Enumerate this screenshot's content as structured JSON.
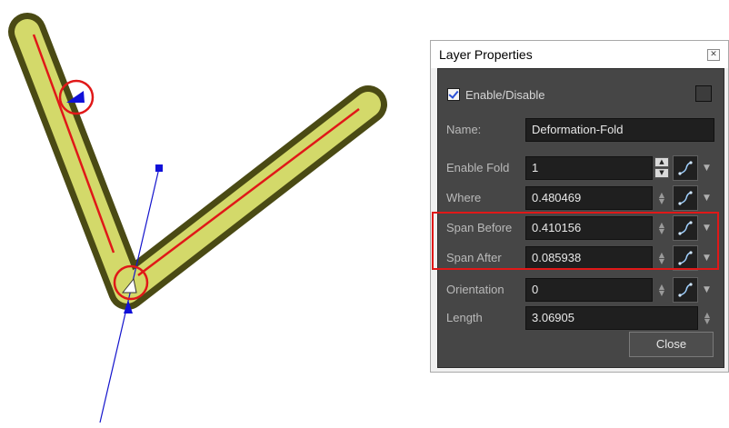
{
  "dialog": {
    "title": "Layer Properties",
    "close_icon": "close-icon",
    "enable": {
      "label": "Enable/Disable",
      "checked": true
    },
    "name": {
      "label": "Name:",
      "value": "Deformation-Fold"
    },
    "rows": [
      {
        "key": "enable_fold",
        "label": "Enable Fold",
        "value": "1"
      },
      {
        "key": "where",
        "label": "Where",
        "value": "0.480469"
      },
      {
        "key": "span_before",
        "label": "Span Before",
        "value": "0.410156"
      },
      {
        "key": "span_after",
        "label": "Span After",
        "value": "0.085938"
      },
      {
        "key": "orientation",
        "label": "Orientation",
        "value": "0"
      },
      {
        "key": "length",
        "label": "Length",
        "value": "3.06905"
      }
    ],
    "close_label": "Close"
  },
  "colors": {
    "deformer_fill": "#d3d96a",
    "deformer_outline": "#4a4a14",
    "deformer_line": "#e01818",
    "handle": "#1010d8",
    "panel_bg": "#464646",
    "highlight": "#e01818"
  }
}
